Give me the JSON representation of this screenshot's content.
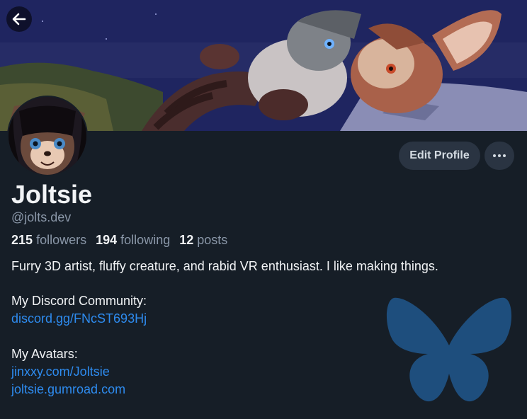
{
  "profile": {
    "display_name": "Joltsie",
    "handle": "@jolts.dev",
    "followers_count": "215",
    "followers_label": "followers",
    "following_count": "194",
    "following_label": "following",
    "posts_count": "12",
    "posts_label": "posts"
  },
  "actions": {
    "edit_profile_label": "Edit Profile",
    "more_icon": "ellipsis-icon",
    "back_icon": "arrow-left-icon"
  },
  "bio": {
    "line1": "Furry 3D artist, fluffy creature, and rabid VR enthusiast. I like making things.",
    "discord_heading": "My Discord Community:",
    "discord_link": "discord.gg/FNcST693Hj",
    "avatars_heading": "My Avatars:",
    "avatar_link1": "jinxxy.com/Joltsie",
    "avatar_link2": "joltsie.gumroad.com"
  },
  "colors": {
    "background": "#161e27",
    "link": "#2e8cf0",
    "muted": "#8a97a8",
    "button_bg": "#2a3442",
    "butterfly": "#1e4e7d"
  }
}
